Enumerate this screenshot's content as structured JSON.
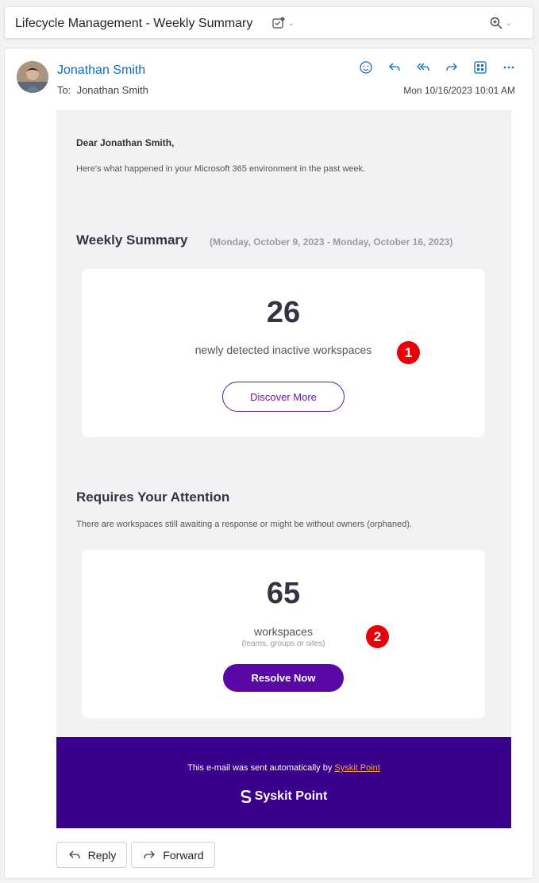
{
  "subject": "Lifecycle Management - Weekly Summary",
  "header_icons": {
    "tag": "tag-check-icon",
    "zoom": "zoom-in-icon"
  },
  "message": {
    "sender": "Jonathan Smith",
    "to_label": "To:",
    "to_name": "Jonathan Smith",
    "date": "Mon 10/16/2023 10:01 AM",
    "actions": [
      "emoji-icon",
      "reply-icon",
      "reply-all-icon",
      "forward-icon",
      "apps-icon",
      "more-icon"
    ]
  },
  "email": {
    "greeting": "Dear Jonathan Smith,",
    "intro": "Here's what happened in your Microsoft 365 environment in the past week.",
    "weekly": {
      "title": "Weekly Summary",
      "date_range": "(Monday, October 9, 2023 - Monday, October 16, 2023)",
      "count": "26",
      "label": "newly detected inactive workspaces",
      "button": "Discover More"
    },
    "attention": {
      "title": "Requires Your Attention",
      "text": "There are workspaces still awaiting a response or might be without owners (orphaned).",
      "count": "65",
      "label": "workspaces",
      "sublabel": "(teams, groups or sites)",
      "button": "Resolve Now"
    },
    "footer": {
      "text": "This e-mail was sent automatically by ",
      "link": "Syskit Point",
      "logo": "Syskit Point"
    }
  },
  "badges": [
    "1",
    "2"
  ],
  "bottom": {
    "reply": "Reply",
    "forward": "Forward"
  },
  "colors": {
    "accent_blue": "#0f6cbd",
    "brand_purple": "#5a08a5",
    "footer_purple": "#3a008c",
    "badge_red": "#e8000b",
    "link_orange": "#f7a23b"
  }
}
